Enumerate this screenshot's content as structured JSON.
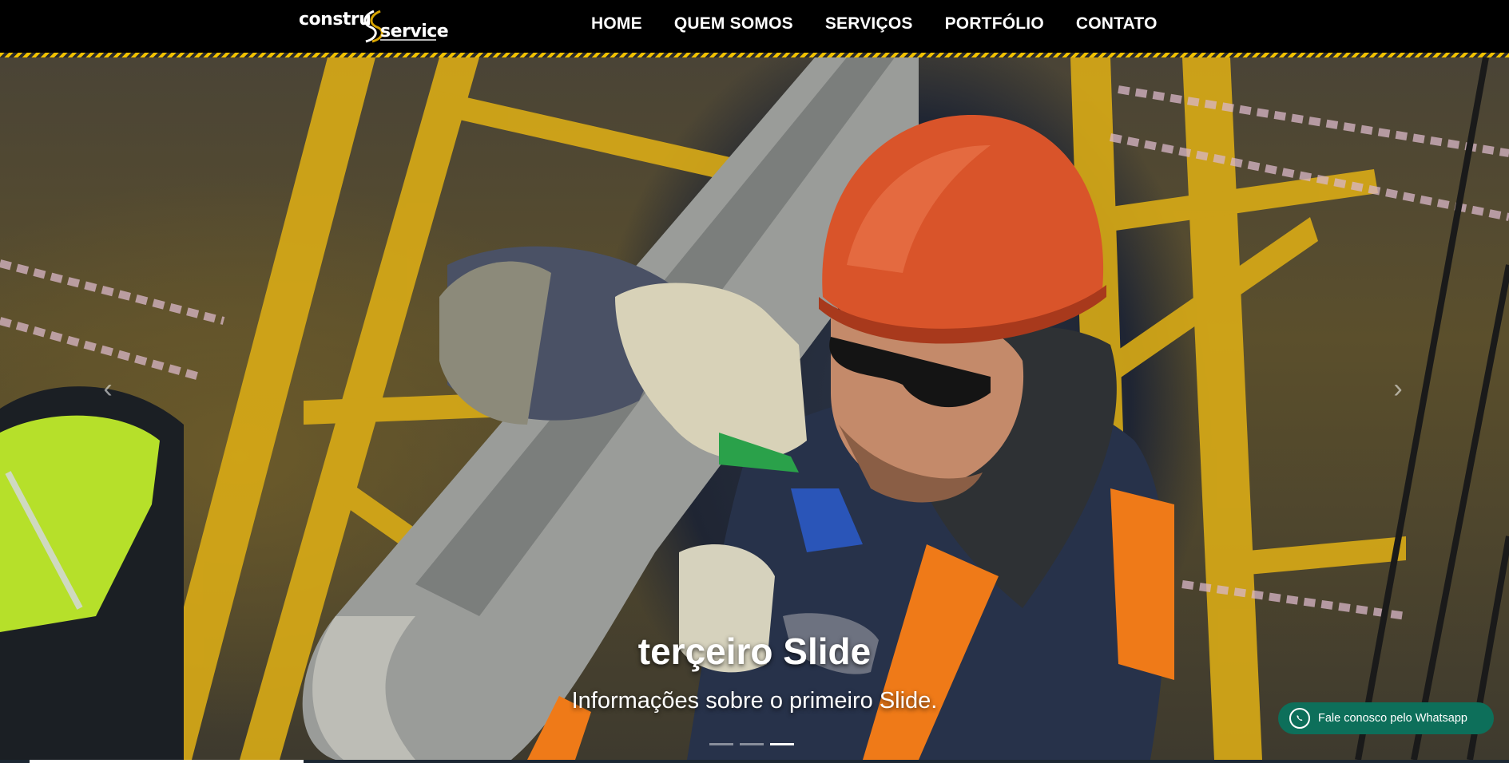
{
  "brand": {
    "logo_left": "constru",
    "logo_right": "service"
  },
  "nav": {
    "items": [
      {
        "label": "HOME"
      },
      {
        "label": "QUEM SOMOS"
      },
      {
        "label": "SERVIÇOS"
      },
      {
        "label": "PORTFÓLIO"
      },
      {
        "label": "CONTATO"
      }
    ]
  },
  "carousel": {
    "prev_icon": "chevron-left-icon",
    "next_icon": "chevron-right-icon",
    "caption_title": "terçeiro Slide",
    "caption_text": "Informações sobre o primeiro Slide.",
    "active_slide": 3,
    "slide_count": 3
  },
  "whatsapp": {
    "label": "Fale conosco pelo Whatsapp",
    "icon": "whatsapp-icon",
    "color": "#0d6f5a"
  },
  "colors": {
    "header_bg": "#000000",
    "stripe_yellow": "#f2c200",
    "scaffold_yellow": "#e0b21a",
    "helmet_orange": "#d9542a"
  }
}
